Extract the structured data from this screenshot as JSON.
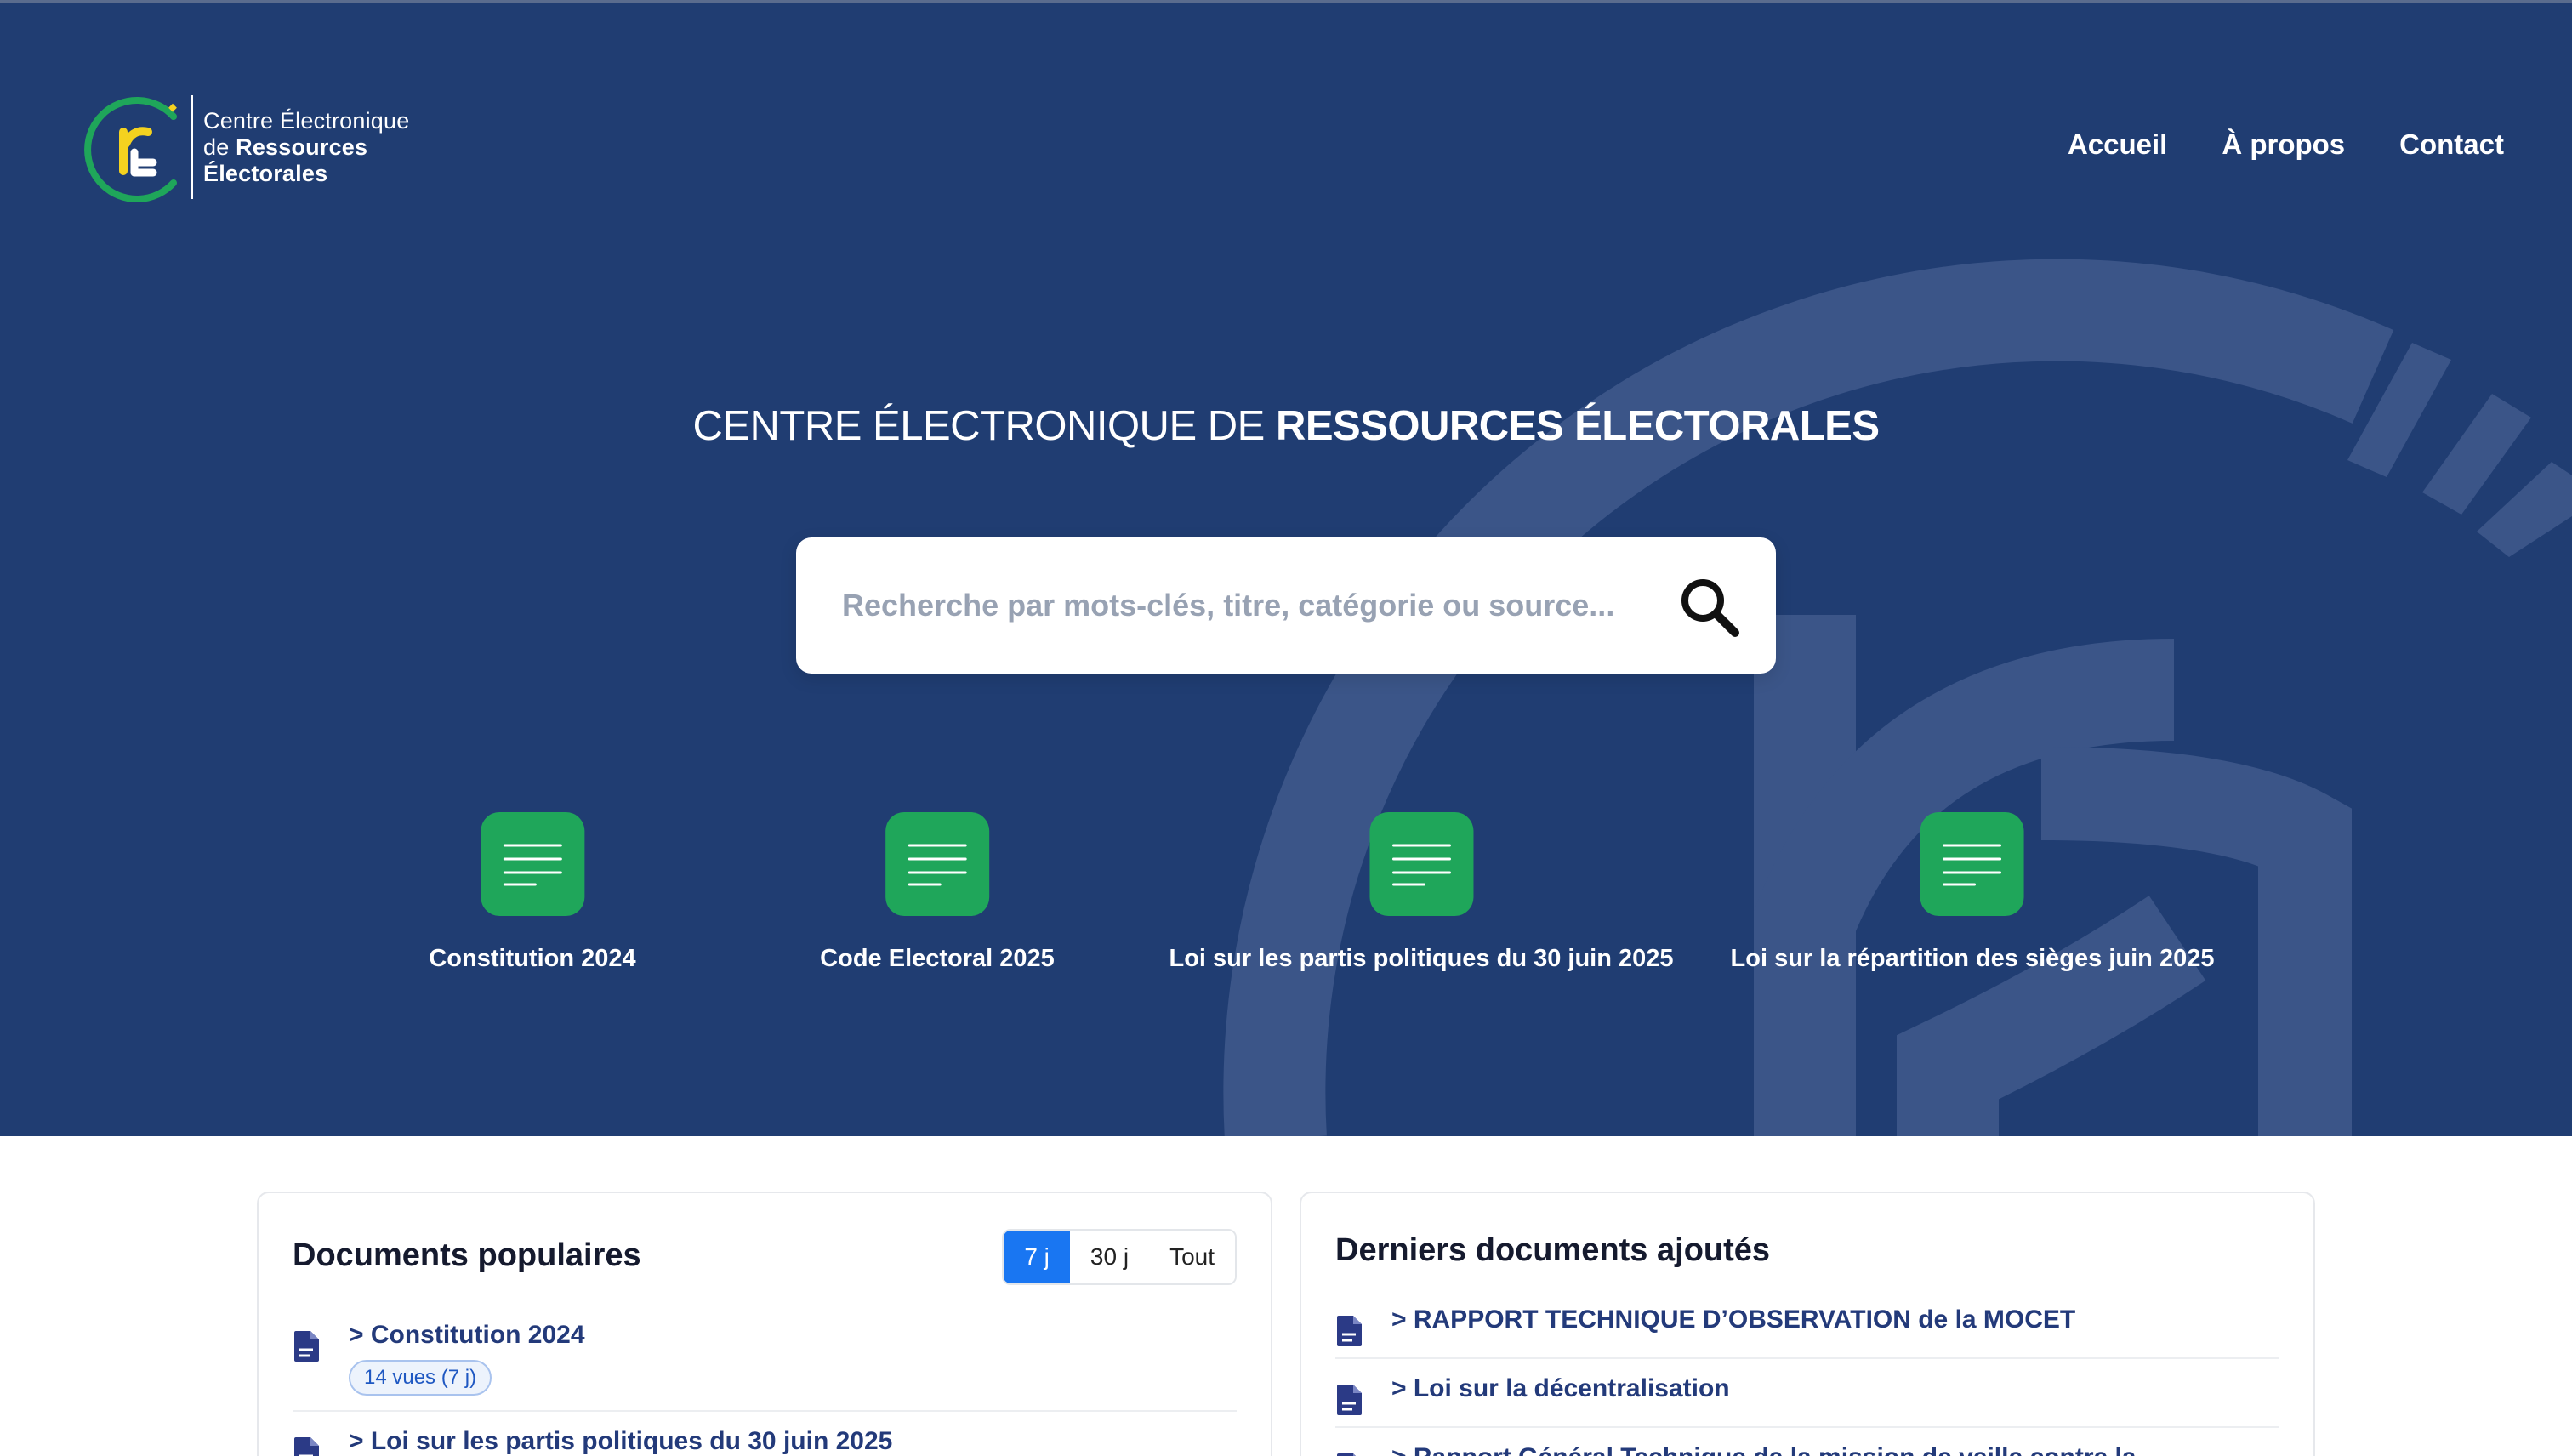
{
  "brand": {
    "line1": "Centre Électronique",
    "line2_pre": "de",
    "line2_bold": "Ressources",
    "line3": "Électorales",
    "colors": {
      "green": "#1fa65a",
      "yellow": "#f4d21f"
    }
  },
  "nav": {
    "items": [
      "Accueil",
      "À propos",
      "Contact"
    ]
  },
  "hero": {
    "title_light": "CENTRE ÉLECTRONIQUE DE",
    "title_bold": "RESSOURCES ÉLECTORALES",
    "background": "#203d72"
  },
  "search": {
    "placeholder": "Recherche par mots-clés, titre, catégorie ou source...",
    "value": "",
    "icon": "search-icon"
  },
  "quick_links": [
    {
      "label": "Constitution 2024",
      "icon": "document-lines-icon"
    },
    {
      "label": "Code Electoral 2025",
      "icon": "document-lines-icon"
    },
    {
      "label": "Loi sur les partis politiques du 30 juin 2025",
      "icon": "document-lines-icon"
    },
    {
      "label": "Loi sur la répartition des sièges juin 2025",
      "icon": "document-lines-icon"
    }
  ],
  "popular": {
    "title": "Documents populaires",
    "filters": [
      "7 j",
      "30 j",
      "Tout"
    ],
    "active_filter": "7 j",
    "items": [
      {
        "title": "> Constitution 2024",
        "views": "14 vues (7 j)"
      },
      {
        "title": "> Loi sur les partis politiques du 30 juin 2025"
      }
    ]
  },
  "latest": {
    "title": "Derniers documents ajoutés",
    "items": [
      {
        "title": "> RAPPORT TECHNIQUE D’OBSERVATION de la MOCET"
      },
      {
        "title": "> Loi sur la décentralisation"
      },
      {
        "title": "> Rapport Général Technique de la mission de veille contre la"
      }
    ]
  },
  "colors": {
    "accent": "#1976f2",
    "tile": "#1fa65a",
    "link": "#233a7a"
  }
}
